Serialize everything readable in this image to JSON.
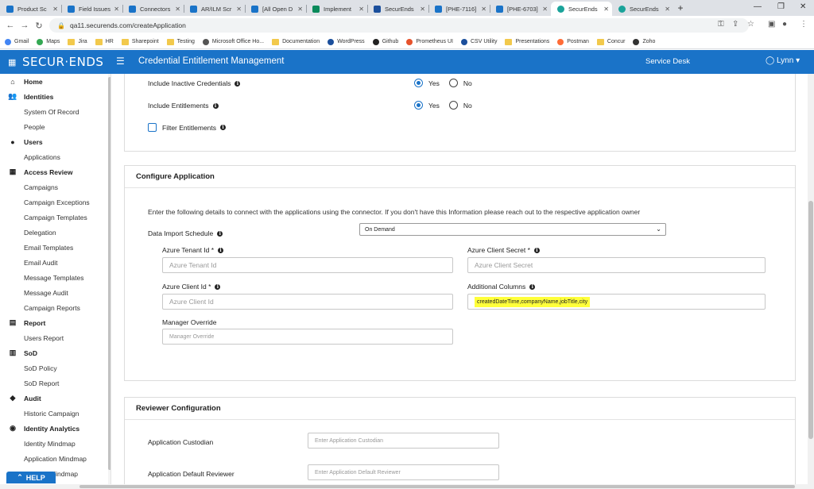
{
  "browser": {
    "tabs": [
      {
        "label": "Product Sc",
        "icon": "tab-favicon",
        "color": "#1a73c8"
      },
      {
        "label": "Field Issues",
        "icon": "tab-favicon",
        "color": "#1a73c8"
      },
      {
        "label": "Connectors",
        "icon": "tab-favicon",
        "color": "#1a73c8"
      },
      {
        "label": "AR/ILM Scr",
        "icon": "tab-favicon",
        "color": "#1a73c8"
      },
      {
        "label": "[All Open D",
        "icon": "tab-favicon",
        "color": "#1a73c8"
      },
      {
        "label": "Implement",
        "icon": "tab-favicon",
        "color": "#0a8a5a"
      },
      {
        "label": "SecurEnds",
        "icon": "tab-favicon",
        "color": "#1b4f9c"
      },
      {
        "label": "[PHE-7116]",
        "icon": "tab-favicon",
        "color": "#1a73c8"
      },
      {
        "label": "[PHE-6703]",
        "icon": "tab-favicon",
        "color": "#1a73c8"
      },
      {
        "label": "SecurEnds",
        "icon": "tab-favicon",
        "color": "#1aa39a"
      },
      {
        "label": "SecurEnds",
        "icon": "tab-favicon",
        "color": "#1aa39a"
      }
    ],
    "active_tab": 9,
    "url": "qa11.securends.com/createApplication",
    "bookmarks": [
      {
        "label": "Gmail",
        "type": "g-icon"
      },
      {
        "label": "Maps",
        "type": "maps-icon"
      },
      {
        "label": "Jira",
        "type": "folder"
      },
      {
        "label": "HR",
        "type": "folder"
      },
      {
        "label": "Sharepoint",
        "type": "folder"
      },
      {
        "label": "Testing",
        "type": "folder"
      },
      {
        "label": "Microsoft Office Ho...",
        "type": "office-icon"
      },
      {
        "label": "Documentation",
        "type": "folder"
      },
      {
        "label": "WordPress",
        "type": "wp-icon"
      },
      {
        "label": "Github",
        "type": "github-icon"
      },
      {
        "label": "Prometheus UI",
        "type": "prom-icon"
      },
      {
        "label": "CSV Utility",
        "type": "csv-icon"
      },
      {
        "label": "Presentations",
        "type": "folder"
      },
      {
        "label": "Postman",
        "type": "postman-icon"
      },
      {
        "label": "Concur",
        "type": "folder"
      },
      {
        "label": "Zoho",
        "type": "zoho-icon"
      }
    ]
  },
  "header": {
    "logo": "SECUR·ENDS",
    "title": "Credential Entitlement Management",
    "service_desk": "Service Desk",
    "user": "Lynn",
    "brand_color": "#1a73c8"
  },
  "sidebar": {
    "items": [
      {
        "type": "section",
        "label": "Home",
        "icon": "home-icon",
        "glyph": "⌂"
      },
      {
        "type": "section",
        "label": "Identities",
        "icon": "users-icon",
        "glyph": "👥"
      },
      {
        "type": "item",
        "label": "System Of Record"
      },
      {
        "type": "item",
        "label": "People"
      },
      {
        "type": "section",
        "label": "Users",
        "icon": "user-icon",
        "glyph": "●"
      },
      {
        "type": "item",
        "label": "Applications"
      },
      {
        "type": "section",
        "label": "Access Review",
        "icon": "grid-icon",
        "glyph": "▦"
      },
      {
        "type": "item",
        "label": "Campaigns"
      },
      {
        "type": "item",
        "label": "Campaign Exceptions"
      },
      {
        "type": "item",
        "label": "Campaign Templates"
      },
      {
        "type": "item",
        "label": "Delegation"
      },
      {
        "type": "item",
        "label": "Email Templates"
      },
      {
        "type": "item",
        "label": "Email Audit"
      },
      {
        "type": "item",
        "label": "Message Templates"
      },
      {
        "type": "item",
        "label": "Message Audit"
      },
      {
        "type": "item",
        "label": "Campaign Reports"
      },
      {
        "type": "section",
        "label": "Report",
        "icon": "report-icon",
        "glyph": "▤"
      },
      {
        "type": "item",
        "label": "Users Report"
      },
      {
        "type": "section",
        "label": "SoD",
        "icon": "sod-icon",
        "glyph": "▥"
      },
      {
        "type": "item",
        "label": "SoD Policy"
      },
      {
        "type": "item",
        "label": "SoD Report"
      },
      {
        "type": "section",
        "label": "Audit",
        "icon": "shield-icon",
        "glyph": "◆"
      },
      {
        "type": "item",
        "label": "Historic Campaign"
      },
      {
        "type": "section",
        "label": "Identity Analytics",
        "icon": "analytics-icon",
        "glyph": "◉"
      },
      {
        "type": "item",
        "label": "Identity Mindmap"
      },
      {
        "type": "item",
        "label": "Application Mindmap"
      },
      {
        "type": "item",
        "label": "Account Mindmap"
      }
    ],
    "help_label": "HELP"
  },
  "options_card": {
    "include_inactive_label": "Include Inactive Credentials",
    "include_entitlements_label": "Include Entitlements",
    "filter_entitlements_label": "Filter Entitlements",
    "yes": "Yes",
    "no": "No"
  },
  "configure_app": {
    "title": "Configure Application",
    "description": "Enter the following details to connect with the applications using the connector. If you don't have this Information please reach out to the respective application owner",
    "schedule_label": "Data Import Schedule",
    "schedule_value": "On Demand",
    "tenant_label": "Azure Tenant Id *",
    "tenant_placeholder": "Azure Tenant Id",
    "secret_label": "Azure Client Secret *",
    "secret_placeholder": "Azure Client Secret",
    "client_label": "Azure Client Id *",
    "client_placeholder": "Azure Client Id",
    "columns_label": "Additional Columns",
    "columns_value": "createdDateTime,companyName,jobTitle,city",
    "manager_label": "Manager Override",
    "manager_placeholder": "Manager Override"
  },
  "reviewer_config": {
    "title": "Reviewer Configuration",
    "custodian_label": "Application Custodian",
    "custodian_placeholder": "Enter Application Custodian",
    "reviewer_label": "Application Default Reviewer",
    "reviewer_placeholder": "Enter Application Default Reviewer"
  }
}
